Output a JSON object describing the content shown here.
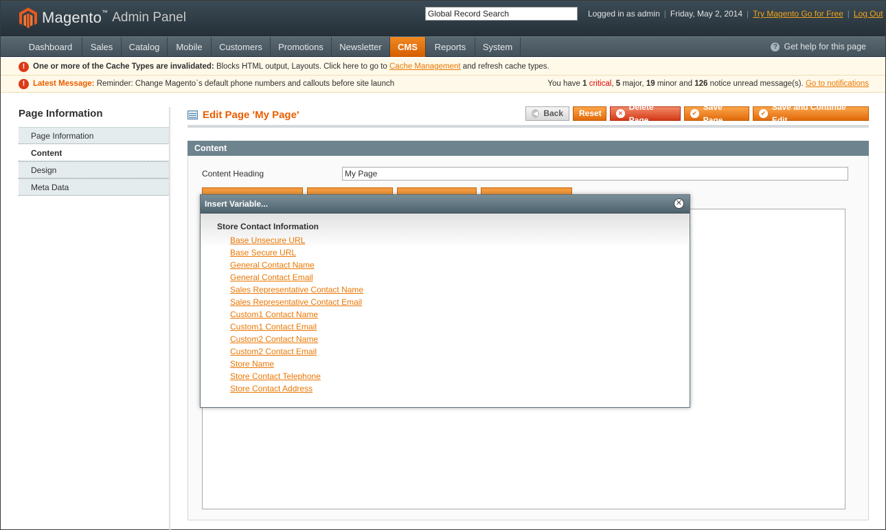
{
  "header": {
    "logo_text": "Magento",
    "logo_tm": "™",
    "logo_sub": "Admin Panel",
    "search_value": "Global Record Search",
    "logged_in": "Logged in as admin",
    "date": "Friday, May 2, 2014",
    "try_link": "Try Magento Go for Free",
    "logout": "Log Out"
  },
  "nav": {
    "items": [
      "Dashboard",
      "Sales",
      "Catalog",
      "Mobile",
      "Customers",
      "Promotions",
      "Newsletter",
      "CMS",
      "Reports",
      "System"
    ],
    "active": "CMS",
    "help": "Get help for this page"
  },
  "messages": {
    "cache_bold": "One or more of the Cache Types are invalidated:",
    "cache_text": "Blocks HTML output, Layouts. Click here to go to",
    "cache_link": "Cache Management",
    "cache_tail": "and refresh cache types.",
    "latest_label": "Latest Message:",
    "latest_text": "Reminder: Change Magento`s default phone numbers and callouts before site launch",
    "summary_prefix": "You have",
    "critical_count": "1",
    "critical_label": "critical",
    "major": "5",
    "major_label": "major,",
    "minor": "19",
    "minor_label": "minor and",
    "notice": "126",
    "notice_label": "notice unread message(s).",
    "notif_link": "Go to notifications"
  },
  "sidebar": {
    "title": "Page Information",
    "tabs": [
      "Page Information",
      "Content",
      "Design",
      "Meta Data"
    ],
    "active": "Content"
  },
  "page": {
    "title": "Edit Page 'My Page'",
    "buttons": {
      "back": "Back",
      "reset": "Reset",
      "delete": "Delete Page",
      "save": "Save Page",
      "save_continue": "Save and Continue Edit"
    }
  },
  "content": {
    "fieldset_title": "Content",
    "heading_label": "Content Heading",
    "heading_value": "My Page"
  },
  "dialog": {
    "title": "Insert Variable...",
    "group": "Store Contact Information",
    "variables": [
      "Base Unsecure URL",
      "Base Secure URL",
      "General Contact Name",
      "General Contact Email",
      "Sales Representative Contact Name",
      "Sales Representative Contact Email",
      "Custom1 Contact Name",
      "Custom1 Contact Email",
      "Custom2 Contact Name",
      "Custom2 Contact Email",
      "Store Name",
      "Store Contact Telephone",
      "Store Contact Address"
    ]
  },
  "colors": {
    "accent": "#eb5e00",
    "link": "#ea7601",
    "header_bg": "#2e3a42",
    "fieldset_head": "#6d838e"
  }
}
